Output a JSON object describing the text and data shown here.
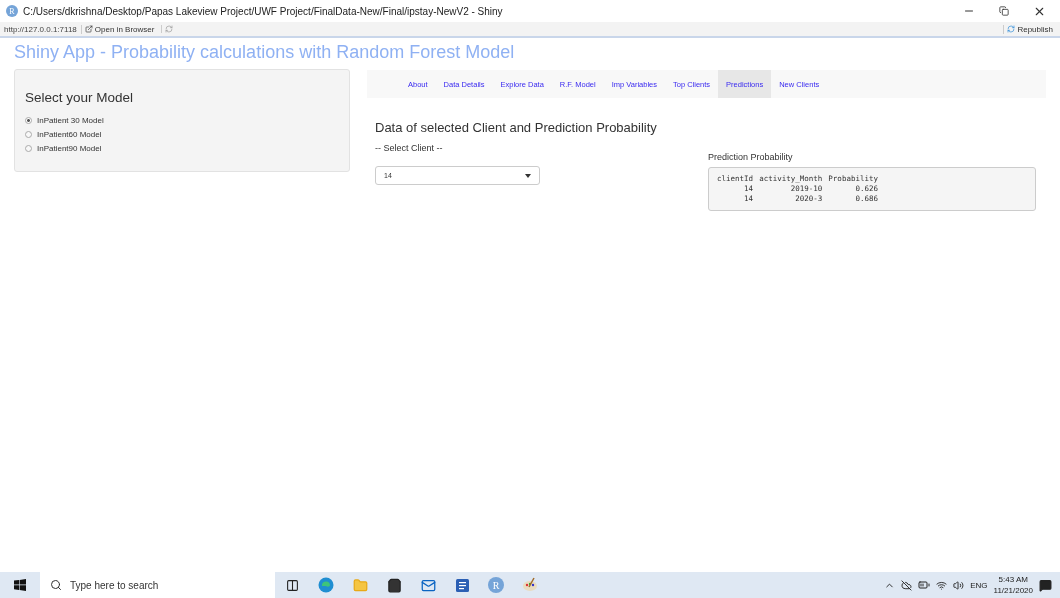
{
  "window": {
    "app_letter": "R",
    "title": "C:/Users/dkrishna/Desktop/Papas Lakeview Project/UWF Project/FinalData-New/Final/ipstay-NewV2 - Shiny"
  },
  "toolbar": {
    "url": "http://127.0.0.1:7118",
    "open_button": "Open in Browser",
    "republish": "Republish"
  },
  "app_title": "Shiny App - Probability calculations with Random Forest Model",
  "sidebar": {
    "heading": "Select your Model",
    "options": [
      {
        "label": "InPatient 30 Model",
        "selected": true
      },
      {
        "label": "InPatient60 Model",
        "selected": false
      },
      {
        "label": "InPatient90 Model",
        "selected": false
      }
    ]
  },
  "tabs": [
    {
      "label": "About",
      "selected": false
    },
    {
      "label": "Data Details",
      "selected": false
    },
    {
      "label": "Explore Data",
      "selected": false
    },
    {
      "label": "R.F. Model",
      "selected": false
    },
    {
      "label": "Imp Variables",
      "selected": false
    },
    {
      "label": "Top Clients",
      "selected": false
    },
    {
      "label": "Predictions",
      "selected": true
    },
    {
      "label": "New Clients",
      "selected": false
    }
  ],
  "main": {
    "heading": "Data of selected Client and Prediction Probability",
    "select_label": "-- Select Client --",
    "select_value": "14",
    "output_heading": "Prediction Probability",
    "table": {
      "columns": [
        "clientId",
        "activity_Month",
        "Probability"
      ],
      "rows": [
        [
          "14",
          "2019-10",
          "0.626"
        ],
        [
          "14",
          "2020-3",
          "0.686"
        ]
      ]
    }
  },
  "taskbar": {
    "search_placeholder": "Type here to search",
    "apps": [
      {
        "kind": "taskview"
      },
      {
        "kind": "edge"
      },
      {
        "kind": "folder"
      },
      {
        "kind": "store"
      },
      {
        "kind": "mail"
      },
      {
        "kind": "word"
      },
      {
        "kind": "r",
        "letter": "R"
      },
      {
        "kind": "paint"
      }
    ],
    "language": "ENG",
    "time": "5:43 AM",
    "date": "11/21/2020"
  }
}
